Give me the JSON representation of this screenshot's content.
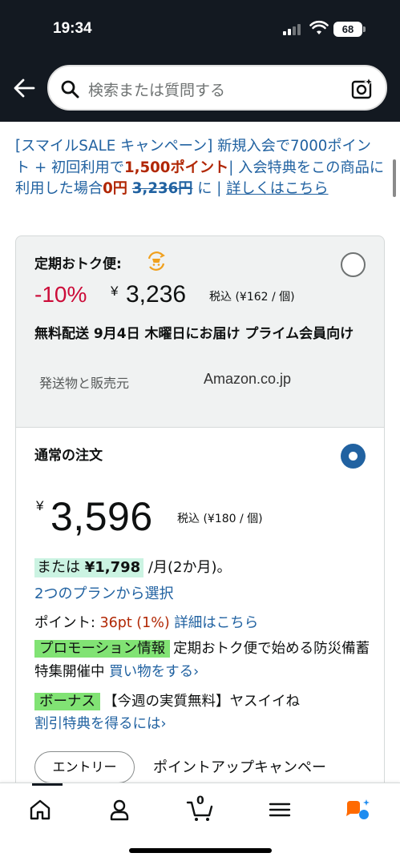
{
  "status_bar": {
    "time": "19:34",
    "battery": "68"
  },
  "search": {
    "placeholder": "検索または質問する"
  },
  "promo_banner": {
    "part1": "[スマイルSALE キャンペーン] 新規入会で7000ポイント + 初回利用で",
    "highlight_points": "1,500ポイント",
    "part2": "| 入会特典をこの商品に利用した場合",
    "zero_price": "0円",
    "strike_price": "3,236円",
    "part3": " に |",
    "link": "詳しくはこちら"
  },
  "subscription": {
    "title": "定期おトク便:",
    "discount": "-10%",
    "yen": "¥",
    "price": "3,236",
    "unit_price": "税込 (¥162 / 個)",
    "delivery": "無料配送 9月4日 木曜日にお届け プライム会員向け",
    "seller_label": "発送物と販売元",
    "seller": "Amazon.co.jp"
  },
  "regular": {
    "title": "通常の注文",
    "yen": "¥",
    "price": "3,596",
    "unit_price": "税込 (¥180 / 個)",
    "installment_prefix": "または ",
    "installment_amount": "¥1,798",
    "installment_suffix": " /月(2か月)。",
    "plan_link": "2つのプランから選択",
    "points_label": "ポイント: ",
    "points_value": "36pt (1%)",
    "points_link": "詳細はこちら",
    "promo_badge": "プロモーション情報",
    "promo_text": "定期おトク便で始める防災備蓄特集開催中",
    "promo_link": "買い物をする›",
    "bonus_badge": "ボーナス",
    "bonus_text": "【今週の実質無料】ヤスイイね",
    "bonus_link": "割引特典を得るには›",
    "entry_button": "エントリー",
    "entry_text": "ポイントアップキャンペー"
  },
  "bottom_nav": {
    "cart_count": "0"
  },
  "colors": {
    "header_bg": "#131921",
    "link": "#2162a1",
    "price_red": "#b12704",
    "discount_red": "#cc0c39",
    "promo_green": "#81e374",
    "installment_mint": "#cbf3e2"
  }
}
